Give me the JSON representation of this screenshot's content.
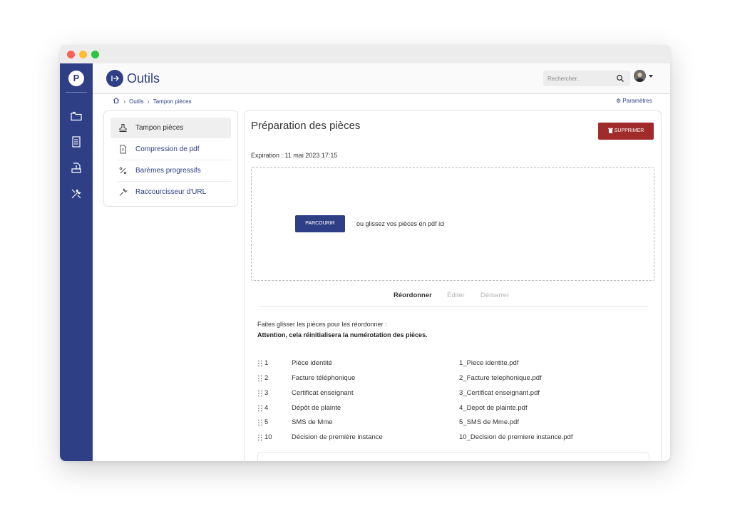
{
  "app": {
    "title": "Outils"
  },
  "search": {
    "placeholder": "Rechercher.."
  },
  "breadcrumb": {
    "items": [
      "Outils",
      "Tampon pièces"
    ]
  },
  "settings": {
    "label": "Paramètres"
  },
  "left_menu": {
    "items": [
      {
        "label": "Tampon pièces",
        "icon": "stamp-icon",
        "active": true
      },
      {
        "label": "Compression de pdf",
        "icon": "pdf-file-icon",
        "active": false
      },
      {
        "label": "Barèmes progressifs",
        "icon": "percent-icon",
        "active": false
      },
      {
        "label": "Raccourcisseur d'URL",
        "icon": "wrench-icon",
        "active": false
      }
    ]
  },
  "main": {
    "title": "Préparation des pièces",
    "delete_label": "SUPPRIMER",
    "expiration": "Expiration : 11 mai 2023 17:15",
    "browse_label": "PARCOURIR",
    "drop_text": "ou glissez vos pièces en pdf ici",
    "tabs": [
      {
        "label": "Réordonner",
        "active": true
      },
      {
        "label": "Éditer",
        "active": false
      },
      {
        "label": "Démarrer",
        "active": false
      }
    ],
    "instruction": "Faites glisser les pièces pour les réordonner :",
    "warning": "Attention, cela réinitialisera la numérotation des pièces.",
    "pieces": [
      {
        "num": "1",
        "name": "Pièce identité",
        "file": "1_Piece identite.pdf"
      },
      {
        "num": "2",
        "name": "Facture téléphonique",
        "file": "2_Facture telephonique.pdf"
      },
      {
        "num": "3",
        "name": "Certificat enseignant",
        "file": "3_Certificat enseignant.pdf"
      },
      {
        "num": "4",
        "name": "Dépôt de plainte",
        "file": "4_Depot de plainte.pdf"
      },
      {
        "num": "5",
        "name": "SMS de Mme",
        "file": "5_SMS de Mme.pdf"
      },
      {
        "num": "10",
        "name": "Décision de première instance",
        "file": "10_Decision de premiere instance.pdf"
      }
    ]
  },
  "colors": {
    "primary": "#2f3f86",
    "danger": "#a12b2b"
  }
}
